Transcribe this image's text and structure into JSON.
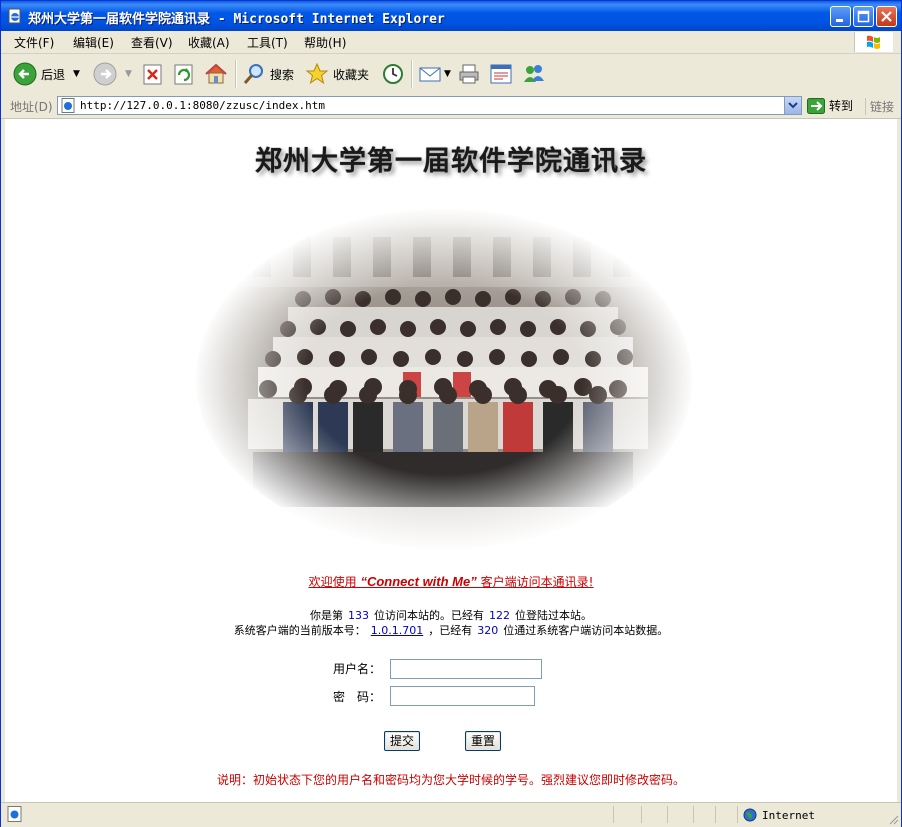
{
  "window": {
    "title": "郑州大学第一届软件学院通讯录 - Microsoft Internet Explorer"
  },
  "menu": {
    "items": [
      "文件(F)",
      "编辑(E)",
      "查看(V)",
      "收藏(A)",
      "工具(T)",
      "帮助(H)"
    ]
  },
  "toolbar": {
    "back_label": "后退",
    "search_label": "搜索",
    "favorites_label": "收藏夹"
  },
  "address": {
    "label": "地址(D)",
    "url": "http://127.0.0.1:8080/zzusc/index.htm",
    "go_label": "转到",
    "links_label": "链接"
  },
  "page": {
    "heading": "郑州大学第一届软件学院通讯录",
    "welcome_prefix": "欢迎使用",
    "welcome_brand": "“Connect with Me”",
    "welcome_suffix": "客户端访问本通讯录!",
    "stats": {
      "line1_a": "你是第",
      "visitor_no": "133",
      "line1_b": "位访问本站的。已经有",
      "logged_in": "122",
      "line1_c": "位登陆过本站。",
      "line2_a": "系统客户端的当前版本号：",
      "version": "1.0.1.701",
      "line2_b": "，已经有",
      "client_users": "320",
      "line2_c": "位通过系统客户端访问本站数据。"
    },
    "form": {
      "username_label": "用户名：",
      "password_label": "密　码：",
      "username_value": "",
      "password_value": "",
      "submit_label": "提交",
      "reset_label": "重置"
    },
    "note": "说明：初始状态下您的用户名和密码均为您大学时候的学号。强烈建议您即时修改密码。"
  },
  "status": {
    "zone": "Internet"
  }
}
